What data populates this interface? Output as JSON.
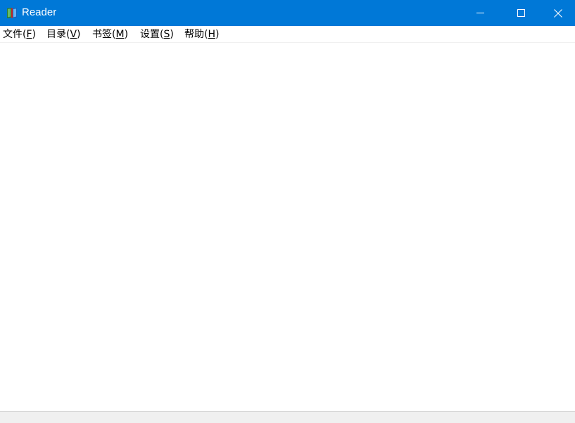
{
  "window": {
    "title": "Reader",
    "app_icon": "book-icon",
    "titlebar_color": "#0078d7",
    "controls": {
      "minimize": "minimize-icon",
      "maximize": "maximize-icon",
      "close": "close-icon"
    }
  },
  "menu": {
    "items": [
      {
        "label": "文件(",
        "key": "F",
        "suffix": ")"
      },
      {
        "label": "目录(",
        "key": "V",
        "suffix": ")"
      },
      {
        "label": "书签(",
        "key": "M",
        "suffix": ")"
      },
      {
        "label": "设置(",
        "key": "S",
        "suffix": ")"
      },
      {
        "label": "帮助(",
        "key": "H",
        "suffix": ")"
      }
    ]
  }
}
